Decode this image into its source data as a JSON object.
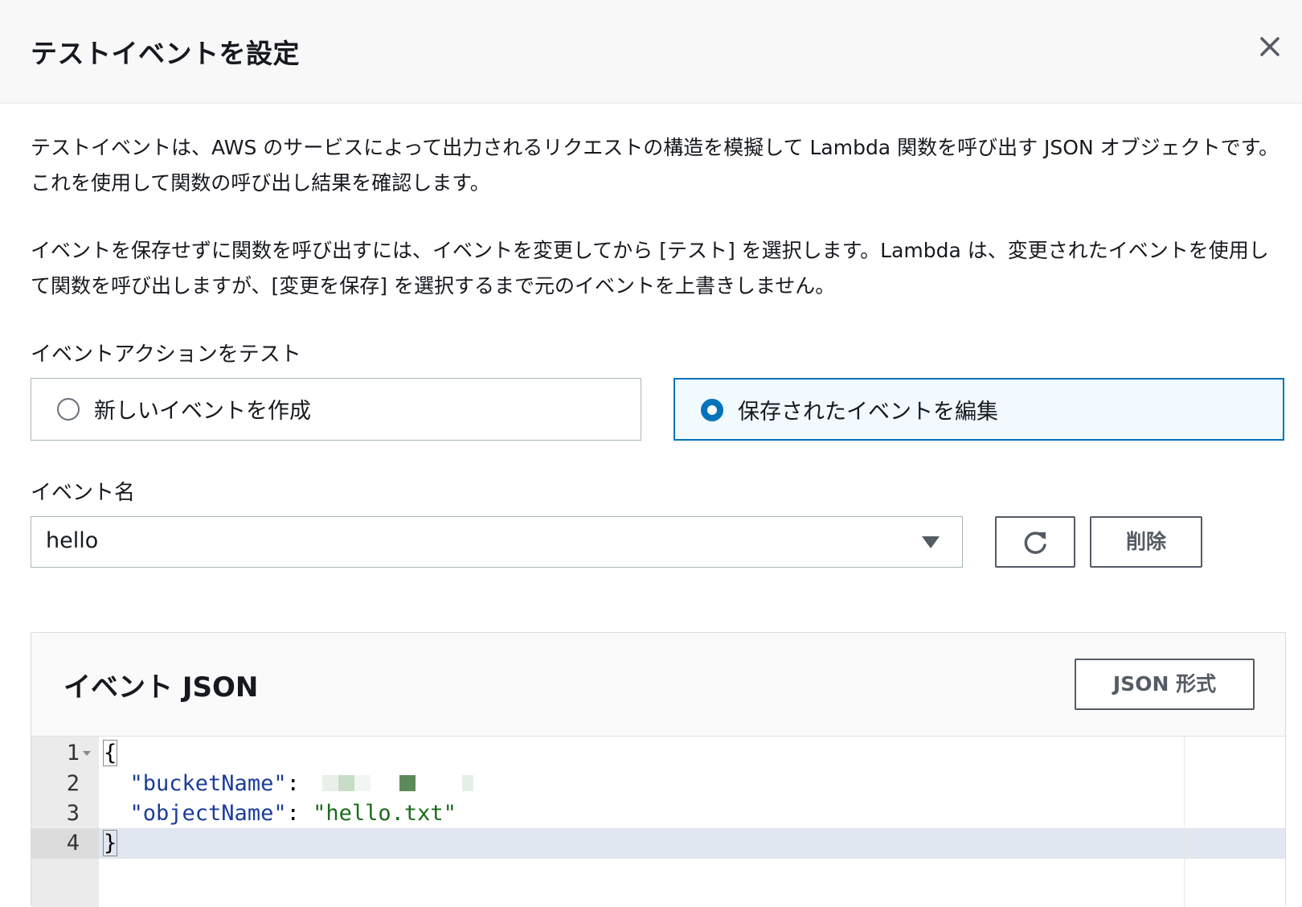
{
  "modal": {
    "title": "テストイベントを設定",
    "close_icon": "close-icon"
  },
  "description": {
    "para1": "テストイベントは、AWS のサービスによって出力されるリクエストの構造を模擬して Lambda 関数を呼び出す JSON オブジェクトです。これを使用して関数の呼び出し結果を確認します。",
    "para2": "イベントを保存せずに関数を呼び出すには、イベントを変更してから [テスト] を選択します。Lambda は、変更されたイベントを使用して関数を呼び出しますが、[変更を保存] を選択するまで元のイベントを上書きしません。"
  },
  "event_action": {
    "label": "イベントアクションをテスト",
    "options": [
      {
        "label": "新しいイベントを作成",
        "selected": false
      },
      {
        "label": "保存されたイベントを編集",
        "selected": true
      }
    ]
  },
  "event_name": {
    "label": "イベント名",
    "value": "hello",
    "refresh_icon": "refresh-icon",
    "delete_label": "削除"
  },
  "event_json": {
    "title": "イベント JSON",
    "format_label": "JSON 形式",
    "lines": [
      {
        "num": "1",
        "text": "{"
      },
      {
        "num": "2",
        "key": "\"bucketName\"",
        "sep": ": "
      },
      {
        "num": "3",
        "key": "\"objectName\"",
        "sep": ": ",
        "value": "\"hello.txt\""
      },
      {
        "num": "4",
        "text": "}"
      }
    ]
  },
  "colors": {
    "accent": "#0073bb",
    "selected_bg": "#f1faff",
    "json_key": "#1a3d99",
    "json_string": "#1b6b1b"
  }
}
